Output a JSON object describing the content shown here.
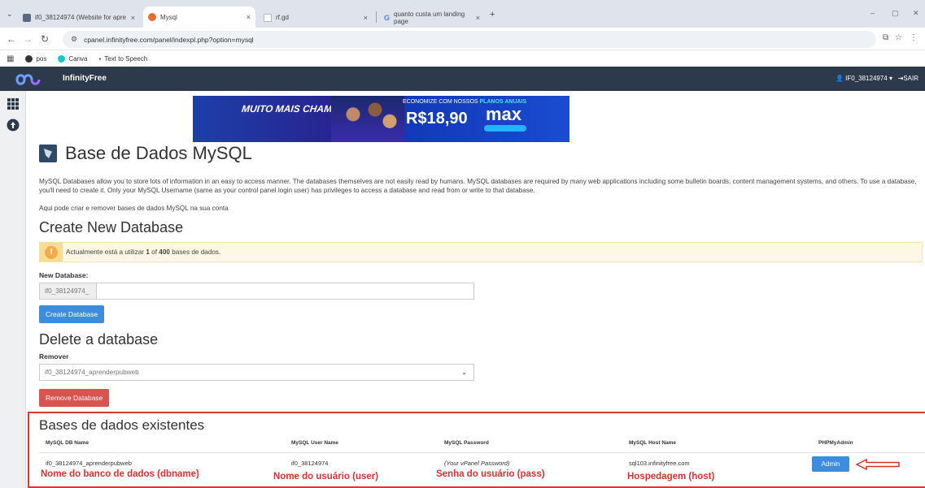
{
  "browser": {
    "tabs": [
      {
        "label": "if0_38124974 (Website for apre",
        "close": "×"
      },
      {
        "label": "Mysql",
        "close": "×"
      },
      {
        "label": "rf.gd",
        "close": "×"
      },
      {
        "label": "quanto custa um landing page",
        "close": "×"
      }
    ],
    "new_tab": "+",
    "window_controls": [
      "–",
      "▢",
      "✕"
    ],
    "url": "cpanel.infinityfree.com/panel/indexpl.php?option=mysql",
    "bookmarks": [
      {
        "label": "pos"
      },
      {
        "label": "Canva"
      },
      {
        "label": "Text to Speech"
      }
    ],
    "overlay_text": "...pag..."
  },
  "navbar": {
    "brand": "InfinityFree",
    "user": "IF0_38124974",
    "logout": "SAIR"
  },
  "banner": {
    "left_text": "MUITO MAIS CHAMPIONS",
    "right_top": "ECONOMIZE COM NOSSOS",
    "right_highlight": "PLANOS ANUAIS",
    "price": "R$18,90",
    "brand": "max"
  },
  "page": {
    "title": "Base de Dados MySQL",
    "description": "MySQL Databases allow you to store lots of information in an easy to access manner. The databases themselves are not easily read by humans. MySQL databases are required by many web applications including some bulletin boards, content management systems, and others. To use a database, you'll need to create it. Only your MySQL Username (same as your control panel login user) has privileges to access a database and read from or write to that database.",
    "subtext": "Aqui pode criar e remover bases de dados MySQL na sua conta"
  },
  "create": {
    "heading": "Create New Database",
    "alert_prefix": "Actualmente está a utilizar ",
    "alert_used": "1",
    "alert_mid": " of ",
    "alert_total": "400",
    "alert_suffix": " bases de dados.",
    "label": "New Database:",
    "prefix": "if0_38124974_",
    "value": "",
    "button": "Create Database"
  },
  "delete": {
    "heading": "Delete a database",
    "label": "Remover",
    "selected": "if0_38124974_aprenderpubweb",
    "button": "Remove Database"
  },
  "existing": {
    "heading": "Bases de dados existentes",
    "columns": [
      "MySQL DB Name",
      "MySQL User Name",
      "MySQL Password",
      "MySQL Host Name",
      "PHPMyAdmin"
    ],
    "row": {
      "db": "if0_38124974_aprenderpubweb",
      "user": "if0_38124974",
      "password": "(Your vPanel Password)",
      "host": "sql103.infinityfree.com",
      "admin": "Admin"
    },
    "annotations": {
      "db": "Nome do banco de dados (dbname)",
      "user": "Nome do usuário (user)",
      "pass": "Senha do usuário (pass)",
      "host": "Hospedagem (host)"
    }
  },
  "colors": {
    "navbar": "#2d3a4b",
    "primary": "#3c8dde",
    "danger": "#d9534f",
    "annotation": "#d8322e"
  }
}
